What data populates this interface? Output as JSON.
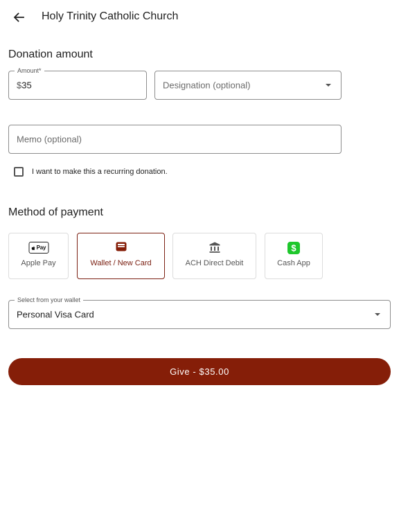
{
  "header": {
    "title": "Holy Trinity Catholic Church"
  },
  "donation": {
    "section_title": "Donation amount",
    "amount_label": "Amount*",
    "currency_prefix": "$",
    "amount_value": "35",
    "designation_placeholder": "Designation (optional)",
    "memo_placeholder": "Memo (optional)",
    "recurring_label": "I want to make this a recurring donation.",
    "recurring_checked": false
  },
  "payment": {
    "section_title": "Method of payment",
    "methods": [
      {
        "label": "Apple Pay",
        "icon": "apple-pay-icon",
        "badge_text": "Pay",
        "selected": false
      },
      {
        "label": "Wallet / New Card",
        "icon": "wallet-icon",
        "selected": true
      },
      {
        "label": "ACH Direct Debit",
        "icon": "bank-icon",
        "selected": false
      },
      {
        "label": "Cash App",
        "icon": "cash-app-icon",
        "selected": false
      }
    ],
    "wallet_label": "Select from your wallet",
    "wallet_value": "Personal Visa Card"
  },
  "give_button": {
    "label": "Give - $35.00"
  },
  "colors": {
    "accent": "#851e08",
    "cash_app_green": "#1ec72c"
  }
}
